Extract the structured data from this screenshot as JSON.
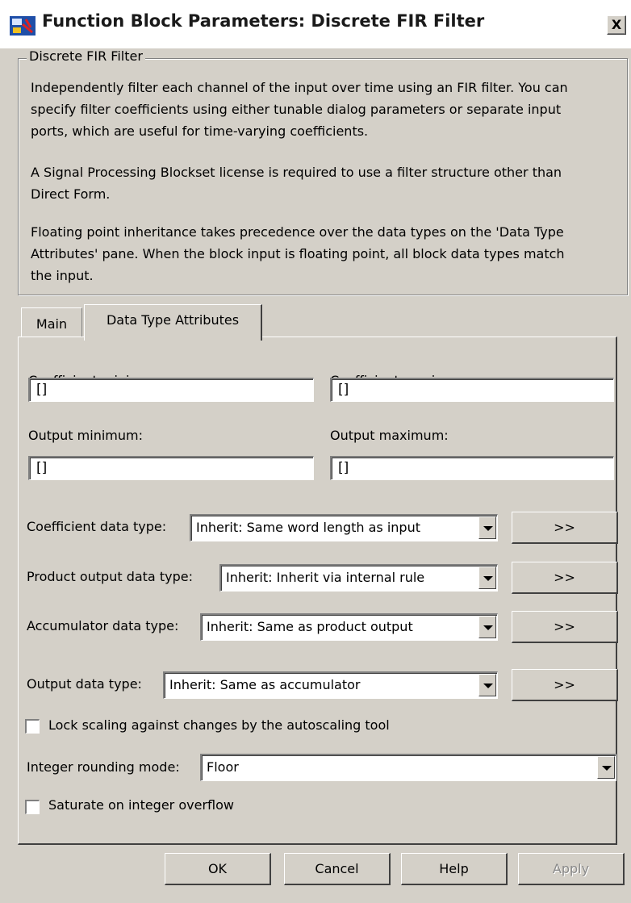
{
  "window": {
    "title": "Function Block Parameters: Discrete FIR Filter",
    "close_label": "X"
  },
  "group": {
    "legend": "Discrete FIR Filter",
    "paragraphs": [
      [
        "Independently filter each channel of the input over time using an FIR filter. You can",
        "specify filter coefficients using either tunable dialog parameters or separate input",
        "ports, which are useful for time-varying coefficients."
      ],
      [
        "A Signal Processing Blockset license is required to use a filter structure other than",
        "Direct Form."
      ],
      [
        "Floating point inheritance takes precedence over the data types on the 'Data Type",
        "Attributes' pane. When the block input is floating point, all block data types match",
        "the input."
      ]
    ]
  },
  "tabs": [
    {
      "label": "Main",
      "active": false
    },
    {
      "label": "Data Type Attributes",
      "active": true
    }
  ],
  "fields": {
    "coef_min": {
      "label": "Coefficient minimum:",
      "value": "[]"
    },
    "coef_max": {
      "label": "Coefficient maximum:",
      "value": "[]"
    },
    "out_min": {
      "label": "Output minimum:",
      "value": "[]"
    },
    "out_max": {
      "label": "Output maximum:",
      "value": "[]"
    }
  },
  "datatypes": {
    "coefficient": {
      "label": "Coefficient data type:",
      "value": "Inherit: Same word length as input",
      "button": ">>"
    },
    "product": {
      "label": "Product output data type:",
      "value": "Inherit: Inherit via internal rule",
      "button": ">>"
    },
    "accumulator": {
      "label": "Accumulator data type:",
      "value": "Inherit: Same as product output",
      "button": ">>"
    },
    "output": {
      "label": "Output data type:",
      "value": "Inherit: Same as accumulator",
      "button": ">>"
    }
  },
  "lock_scaling": {
    "label": "Lock scaling against changes by the autoscaling tool",
    "checked": false
  },
  "rounding": {
    "label": "Integer rounding mode:",
    "value": "Floor"
  },
  "saturate": {
    "label": "Saturate on integer overflow",
    "checked": false
  },
  "buttons": {
    "ok": "OK",
    "cancel": "Cancel",
    "help": "Help",
    "apply": "Apply"
  }
}
